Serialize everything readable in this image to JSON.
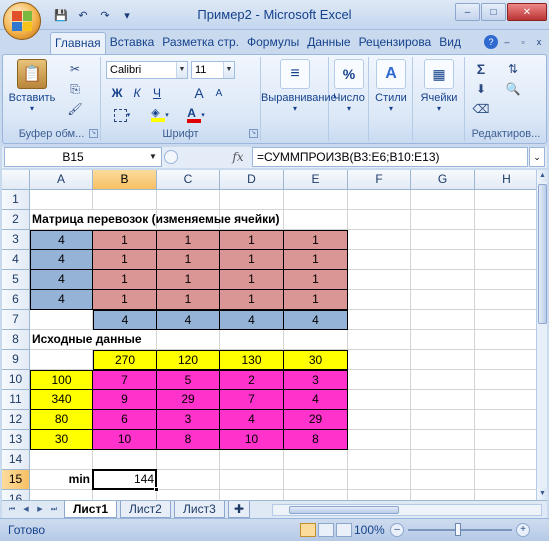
{
  "window": {
    "title": "Пример2 - Microsoft Excel",
    "controls": {
      "minimize": "–",
      "maximize": "□",
      "close": "✕"
    }
  },
  "quick_access": {
    "save": "💾",
    "undo": "↶",
    "redo": "↷",
    "more": "▾"
  },
  "ribbon_tabs": [
    "Главная",
    "Вставка",
    "Разметка стр.",
    "Формулы",
    "Данные",
    "Рецензирова",
    "Вид"
  ],
  "active_tab": "Главная",
  "ribbon": {
    "clipboard": {
      "label": "Буфер обм...",
      "paste": "Вставить"
    },
    "font": {
      "label": "Шрифт",
      "font_name": "Calibri",
      "font_size": "11",
      "bold": "Ж",
      "italic": "К",
      "underline": "Ч",
      "grow": "A",
      "shrink": "A",
      "font_color_letter": "A"
    },
    "alignment": {
      "label": "Выравнивание"
    },
    "number": {
      "label": "Число",
      "icon_text": "%"
    },
    "styles": {
      "label": "Стили"
    },
    "cells": {
      "label": "Ячейки"
    },
    "editing": {
      "label": "Редактиров...",
      "sum": "Σ"
    }
  },
  "formula_bar": {
    "name_box": "B15",
    "fx": "fx",
    "formula": "=СУММПРОИЗВ(B3:E6;B10:E13)"
  },
  "columns": [
    "A",
    "B",
    "C",
    "D",
    "E",
    "F",
    "G",
    "H"
  ],
  "rows": [
    "1",
    "2",
    "3",
    "4",
    "5",
    "6",
    "7",
    "8",
    "9",
    "10",
    "11",
    "12",
    "13",
    "14",
    "15",
    "16"
  ],
  "cells": {
    "A2": "Матрица перевозок (изменяемые ячейки)",
    "A3": "4",
    "B3": "1",
    "C3": "1",
    "D3": "1",
    "E3": "1",
    "A4": "4",
    "B4": "1",
    "C4": "1",
    "D4": "1",
    "E4": "1",
    "A5": "4",
    "B5": "1",
    "C5": "1",
    "D5": "1",
    "E5": "1",
    "A6": "4",
    "B6": "1",
    "C6": "1",
    "D6": "1",
    "E6": "1",
    "B7": "4",
    "C7": "4",
    "D7": "4",
    "E7": "4",
    "A8": "Исходные данные",
    "B9": "270",
    "C9": "120",
    "D9": "130",
    "E9": "30",
    "A10": "100",
    "B10": "7",
    "C10": "5",
    "D10": "2",
    "E10": "3",
    "A11": "340",
    "B11": "9",
    "C11": "29",
    "D11": "7",
    "E11": "4",
    "A12": "80",
    "B12": "6",
    "C12": "3",
    "D12": "4",
    "E12": "29",
    "A13": "30",
    "B13": "10",
    "C13": "8",
    "D13": "10",
    "E13": "8",
    "A15": "min",
    "B15": "144"
  },
  "fill_colors": {
    "blue": "#95b3d7",
    "pink": "#da9694",
    "yellow": "#ffff00",
    "magenta": "#ff33cc"
  },
  "sheets": [
    "Лист1",
    "Лист2",
    "Лист3"
  ],
  "active_sheet": "Лист1",
  "status": {
    "text": "Готово",
    "zoom": "100%"
  }
}
